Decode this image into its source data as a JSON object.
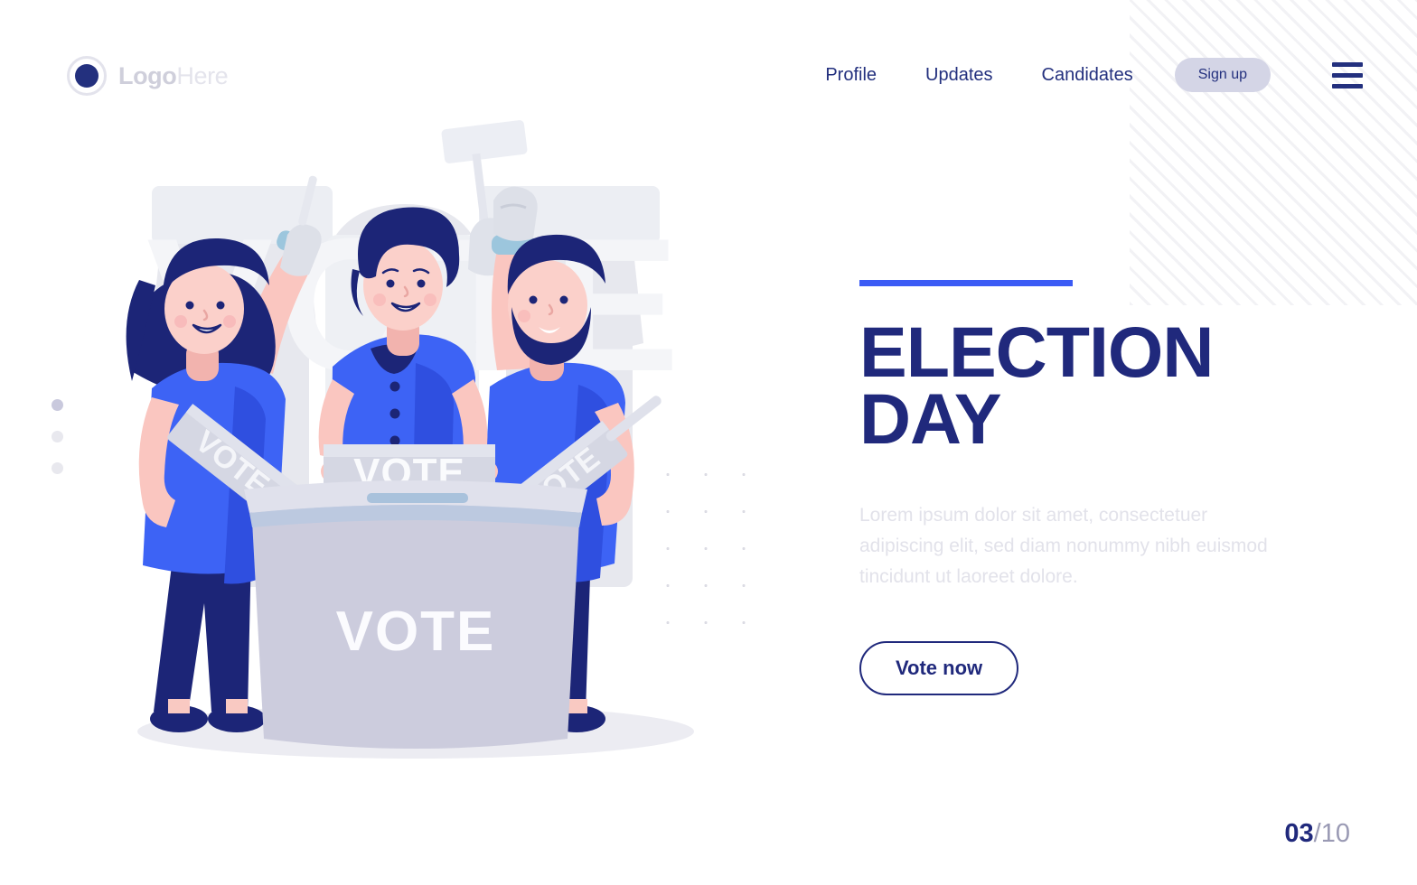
{
  "brand": {
    "logo_primary": "Logo",
    "logo_secondary": "Here",
    "logo_icon": "circle-logo-icon"
  },
  "nav": {
    "links": [
      {
        "label": "Profile"
      },
      {
        "label": "Updates"
      },
      {
        "label": "Candidates"
      }
    ],
    "signup_label": "Sign up",
    "menu_icon": "hamburger-menu-icon"
  },
  "hero": {
    "headline_line1": "ELECTION",
    "headline_line2": "DAY",
    "body": "Lorem ipsum dolor sit amet, consectetuer adipiscing elit, sed diam nonummy nibh euismod tincidunt ut laoreet dolore.",
    "cta_label": "Vote now"
  },
  "illustration": {
    "ballot_box_label": "VOTE",
    "sign_left_label": "VOTE",
    "sign_center_label": "VOTE",
    "sign_right_label": "VOTE"
  },
  "pager": {
    "dots": [
      {
        "state": "active"
      },
      {
        "state": "inactive"
      },
      {
        "state": "inactive"
      }
    ],
    "current": "03",
    "total": "/10"
  },
  "colors": {
    "navy": "#20297c",
    "accent_blue": "#3b5bf5",
    "shirt_blue": "#3d63f5",
    "signup_pill": "#d4d5e6",
    "muted_text": "#e2e2ea",
    "box_gray": "#ccccdd"
  }
}
